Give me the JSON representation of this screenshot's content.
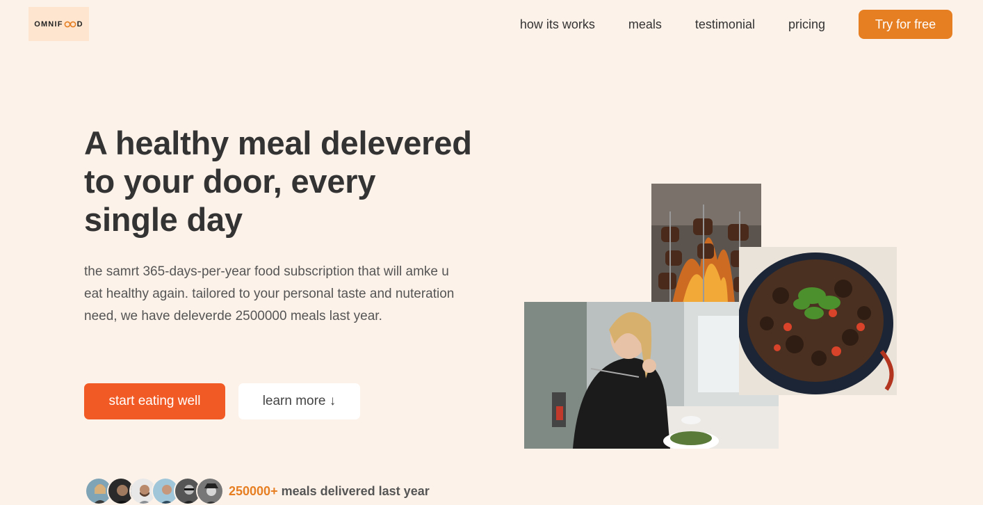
{
  "brand": {
    "name_left": "OMNIF",
    "name_right": "D",
    "logo_icon": "infinity-icon"
  },
  "nav": {
    "links": [
      "how its works",
      "meals",
      "testimonial",
      "pricing"
    ],
    "cta": "Try for free"
  },
  "hero": {
    "title": "A healthy meal delevered to your door, every single day",
    "description": "the samrt 365-days-per-year food subscription that will amke u eat healthy again. tailored to your personal taste and nuteration need, we have deleverde 2500000 meals last year.",
    "primary_button": "start eating well",
    "secondary_button": "learn more ↓"
  },
  "delivered": {
    "count": "250000+",
    "text": " meals delivered last year"
  },
  "colors": {
    "background": "#fdf2e9",
    "accent": "#e67e22",
    "primary_button": "#f15a24"
  }
}
